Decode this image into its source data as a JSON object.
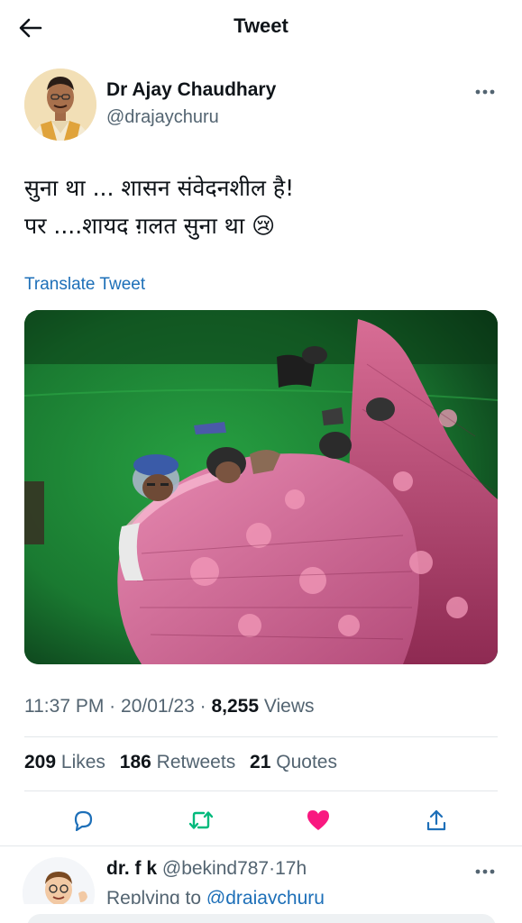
{
  "header": {
    "title": "Tweet",
    "back_icon": "arrow-left-icon"
  },
  "author": {
    "name": "Dr Ajay Chaudhary",
    "handle": "@drajaychuru",
    "more_icon": "more-horizontal-icon"
  },
  "tweet": {
    "lines": [
      "सुना था ... शासन संवेदनशील है!",
      "पर ....शायद ग़लत सुना था 😢"
    ],
    "translate_label": "Translate Tweet",
    "media_icon": "photo-policemen-sleeping-under-quilts"
  },
  "meta": {
    "time": "11:37 PM",
    "sep1": "·",
    "date": "20/01/23",
    "sep2": "·",
    "views_count": "8,255",
    "views_label": "Views"
  },
  "stats": {
    "likes_count": "209",
    "likes_label": "Likes",
    "retweets_count": "186",
    "retweets_label": "Retweets",
    "quotes_count": "21",
    "quotes_label": "Quotes"
  },
  "actions": {
    "reply_icon": "reply-icon",
    "retweet_icon": "retweet-icon",
    "like_icon": "heart-icon",
    "share_icon": "share-icon",
    "retweet_color": "#00ba7c",
    "like_color": "#f91880"
  },
  "reply": {
    "name": "dr. f k",
    "handle": "@bekind787",
    "sep": "·",
    "time": "17h",
    "replying_prefix": "Replying to",
    "replying_handle": "@drajaychuru"
  },
  "colors": {
    "link": "#1d6fb8",
    "secondary_text": "#536471",
    "primary_text": "#0f1419"
  }
}
